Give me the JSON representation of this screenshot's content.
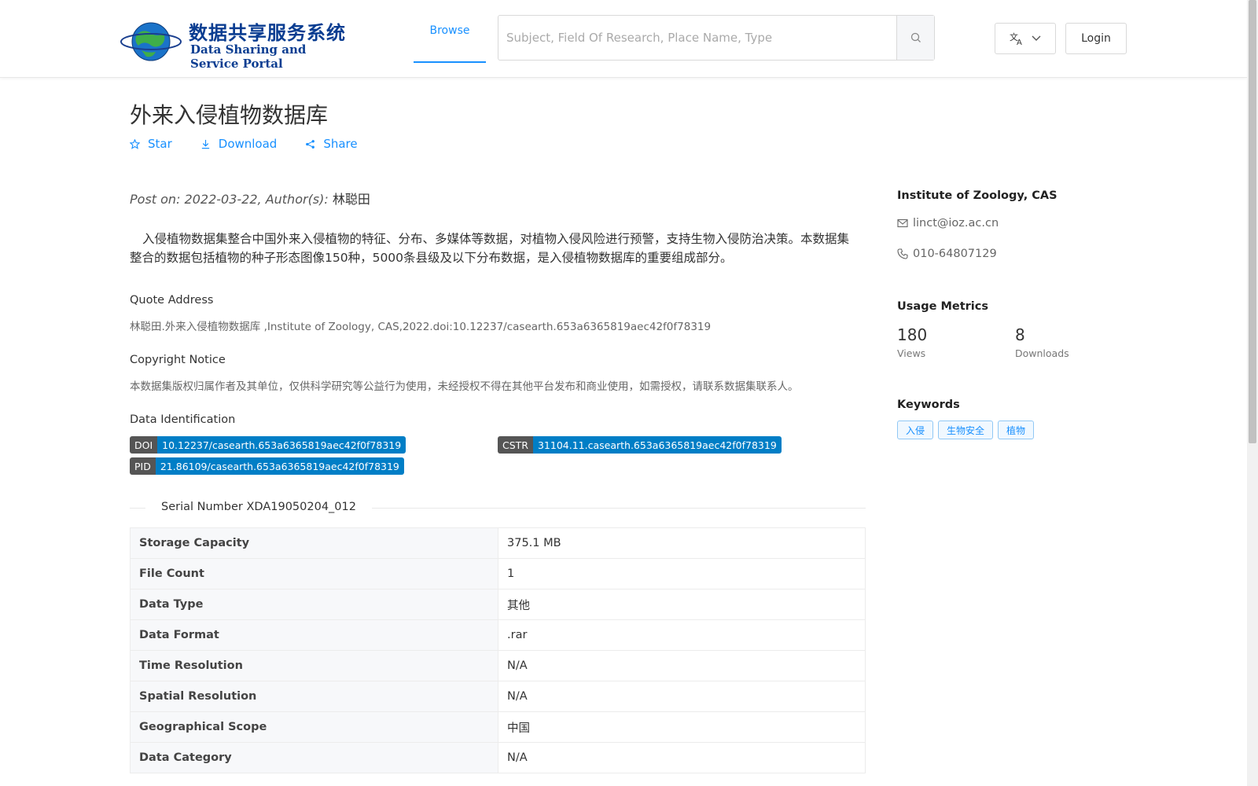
{
  "header": {
    "logo_cn": "数据共享服务系统",
    "logo_en": "Data Sharing and Service Portal",
    "nav_browse": "Browse",
    "search_placeholder": "Subject, Field Of Research, Place Name, Type",
    "login": "Login"
  },
  "dataset": {
    "title": "外来入侵植物数据库",
    "actions": {
      "star": "Star",
      "download": "Download",
      "share": "Share"
    },
    "meta_prefix": "Post on: 2022-03-22, Author(s): ",
    "author": "林聪田",
    "description": "入侵植物数据集整合中国外来入侵植物的特征、分布、多媒体等数据，对植物入侵风险进行预警，支持生物入侵防治决策。本数据集整合的数据包括植物的种子形态图像150种，5000条县级及以下分布数据，是入侵植物数据库的重要组成部分。",
    "quote_title": "Quote Address",
    "quote_text": "林聪田.外来入侵植物数据库 ,Institute of Zoology, CAS,2022.doi:10.12237/casearth.653a6365819aec42f0f78319",
    "copyright_title": "Copyright Notice",
    "copyright_text": "本数据集版权归属作者及其单位，仅供科学研究等公益行为使用，未经授权不得在其他平台发布和商业使用，如需授权，请联系数据集联系人。",
    "ident_title": "Data Identification",
    "identifiers": {
      "doi_key": "DOI",
      "doi_val": "10.12237/casearth.653a6365819aec42f0f78319",
      "cstr_key": "CSTR",
      "cstr_val": "31104.11.casearth.653a6365819aec42f0f78319",
      "pid_key": "PID",
      "pid_val": "21.86109/casearth.653a6365819aec42f0f78319"
    },
    "serial_number": "Serial Number XDA19050204_012",
    "info_rows": [
      {
        "label": "Storage Capacity",
        "value": "375.1 MB"
      },
      {
        "label": "File Count",
        "value": "1"
      },
      {
        "label": "Data Type",
        "value": "其他"
      },
      {
        "label": "Data Format",
        "value": ".rar"
      },
      {
        "label": "Time Resolution",
        "value": "N/A"
      },
      {
        "label": "Spatial Resolution",
        "value": "N/A"
      },
      {
        "label": "Geographical Scope",
        "value": "中国"
      },
      {
        "label": "Data Category",
        "value": "N/A"
      }
    ]
  },
  "sidebar": {
    "institution": "Institute of Zoology, CAS",
    "email": "linct@ioz.ac.cn",
    "phone": "010-64807129",
    "metrics_title": "Usage Metrics",
    "views_count": "180",
    "views_label": "Views",
    "downloads_count": "8",
    "downloads_label": "Downloads",
    "keywords_title": "Keywords",
    "keywords": [
      "入侵",
      "生物安全",
      "植物"
    ]
  },
  "colors": {
    "accent": "#1890ff",
    "tag_key": "#555555",
    "tag_value": "#007ec6",
    "logo": "#0a3d91"
  }
}
